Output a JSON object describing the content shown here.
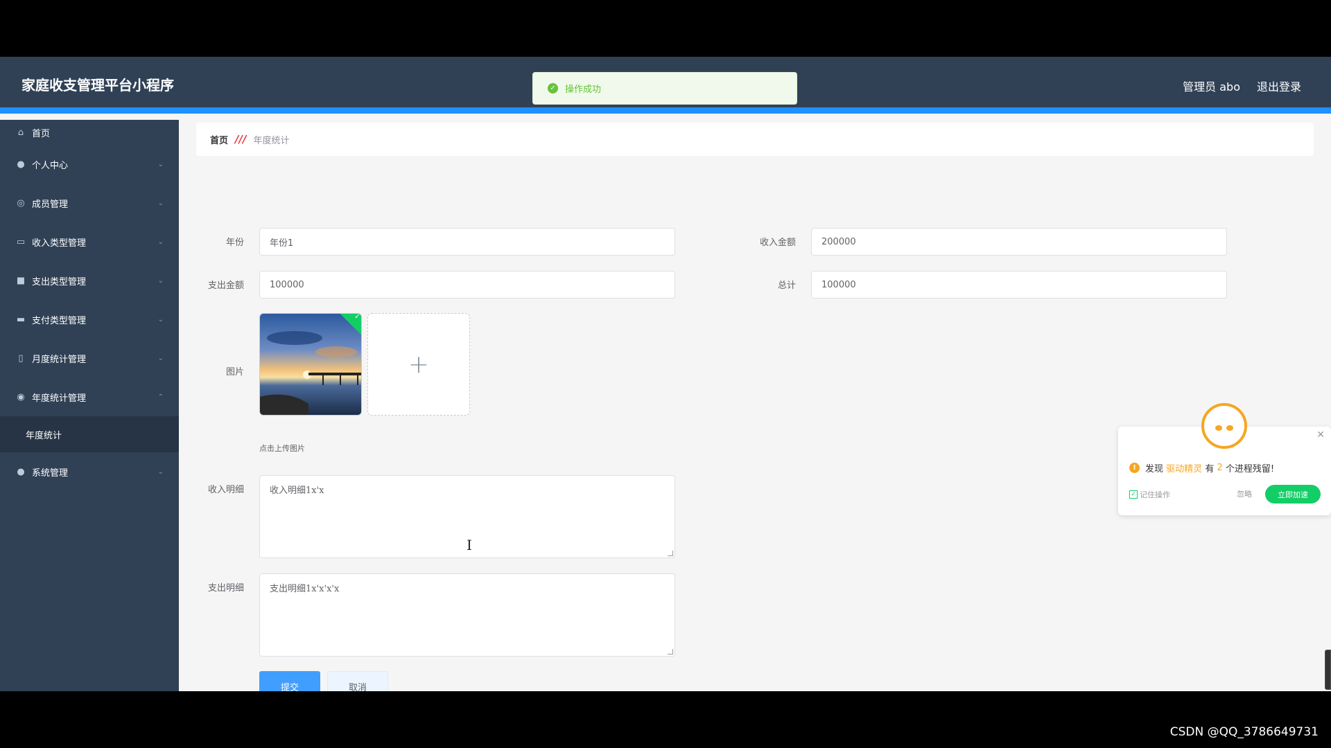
{
  "header": {
    "title": "家庭收支管理平台小程序",
    "admin_label": "管理员 abo",
    "logout_label": "退出登录"
  },
  "toast": {
    "text": "操作成功"
  },
  "sidebar": {
    "items": [
      {
        "label": "首页",
        "icon": "home-icon"
      },
      {
        "label": "个人中心",
        "icon": "user-icon"
      },
      {
        "label": "成员管理",
        "icon": "compass-icon"
      },
      {
        "label": "收入类型管理",
        "icon": "message-icon"
      },
      {
        "label": "支出类型管理",
        "icon": "video-icon"
      },
      {
        "label": "支付类型管理",
        "icon": "chat-icon"
      },
      {
        "label": "月度统计管理",
        "icon": "phone-icon"
      },
      {
        "label": "年度统计管理",
        "icon": "target-icon"
      },
      {
        "label": "系统管理",
        "icon": "user-icon"
      }
    ],
    "subitem": "年度统计"
  },
  "breadcrumb": {
    "home": "首页",
    "current": "年度统计"
  },
  "form": {
    "year_label": "年份",
    "year_value": "年份1",
    "income_label": "收入金额",
    "income_value": "200000",
    "expense_label": "支出金额",
    "expense_value": "100000",
    "total_label": "总计",
    "total_value": "100000",
    "image_label": "图片",
    "upload_tip": "点击上传图片",
    "income_detail_label": "收入明细",
    "income_detail_value": "收入明细1x'x",
    "expense_detail_label": "支出明细",
    "expense_detail_value": "支出明细1x'x'x'x",
    "submit_label": "提交",
    "cancel_label": "取消"
  },
  "popup": {
    "msg_prefix": "发现",
    "msg_highlight": "驱动精灵",
    "msg_mid": "有",
    "msg_count": "2",
    "msg_suffix": "个进程残留!",
    "remember_label": "记住操作",
    "ignore_label": "忽略",
    "action_label": "立即加速"
  },
  "watermark": "CSDN @QQ_3786649731"
}
